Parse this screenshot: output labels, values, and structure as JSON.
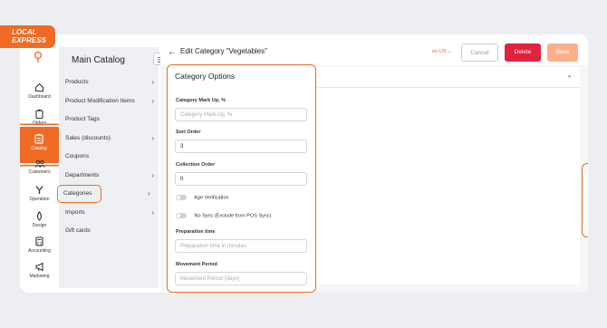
{
  "brand": {
    "line1": "LOCAL",
    "line2": "EXPRESS"
  },
  "colors": {
    "accent": "#f06a25",
    "danger": "#e3223d",
    "save_disabled": "#fbb08a"
  },
  "sidebar": {
    "items": [
      {
        "label": "Dashboard",
        "icon": "home-icon"
      },
      {
        "label": "Orders",
        "icon": "clipboard-icon"
      },
      {
        "label": "Catalog",
        "icon": "catalog-icon",
        "active": true
      },
      {
        "label": "Customers",
        "icon": "customers-icon"
      },
      {
        "label": "Operation",
        "icon": "operation-icon"
      },
      {
        "label": "Design",
        "icon": "design-icon"
      },
      {
        "label": "Accounting",
        "icon": "calculator-icon"
      },
      {
        "label": "Marketing",
        "icon": "megaphone-icon"
      }
    ]
  },
  "menu": {
    "title": "Main Catalog",
    "items": [
      {
        "label": "Products",
        "chevron": true
      },
      {
        "label": "Product Modification Items",
        "chevron": true
      },
      {
        "label": "Product Tags",
        "chevron": false
      },
      {
        "label": "Sales (discounts)",
        "chevron": true
      },
      {
        "label": "Coupons",
        "chevron": false
      },
      {
        "label": "Departments",
        "chevron": true
      },
      {
        "label": "Categories",
        "chevron": true,
        "highlighted": true
      },
      {
        "label": "Imports",
        "chevron": true
      },
      {
        "label": "Gift cards",
        "chevron": false
      }
    ]
  },
  "header": {
    "title": "Edit Category \"Vegetables\"",
    "language": "en-US",
    "cancel_label": "Cancel",
    "delete_label": "Delete",
    "save_label": "Save"
  },
  "form": {
    "section_title": "Category Options",
    "markup_label": "Category Mark Up, %",
    "markup_placeholder": "Category Mark Up, %",
    "sort_label": "Sort Order",
    "sort_value": "3",
    "collection_label": "Collection Order",
    "collection_value": "0",
    "age_label": "Age Verification",
    "nosync_label": "No Sync (Exclude from POS Sync)",
    "prep_label": "Preparation time",
    "prep_placeholder": "Preparation time in minutes",
    "movement_label": "Movement Period",
    "movement_placeholder": "Movement Period (days)"
  }
}
